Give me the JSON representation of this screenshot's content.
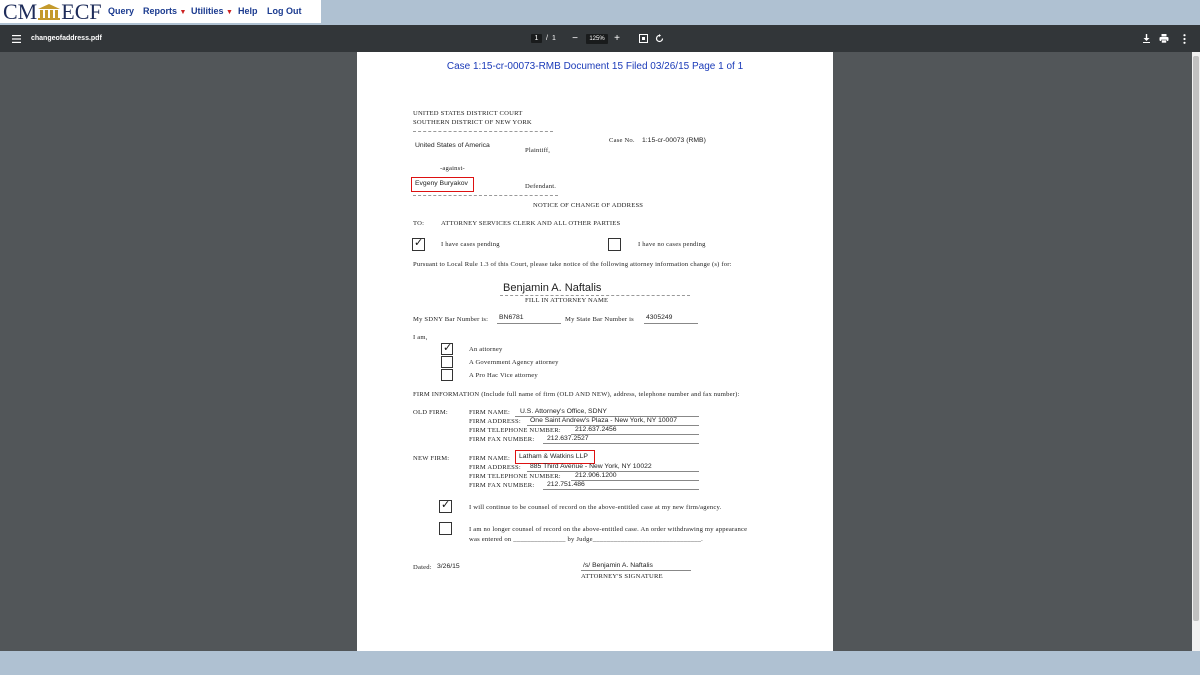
{
  "app": {
    "logo_left": "CM",
    "logo_right": "ECF",
    "menu": [
      {
        "label": "Query"
      },
      {
        "label": "Reports"
      },
      {
        "label": "Utilities"
      },
      {
        "label": "Help"
      },
      {
        "label": "Log Out"
      }
    ]
  },
  "viewer": {
    "filename": "changeofaddress.pdf",
    "page_current": "1",
    "page_sep": "/",
    "page_total": "1",
    "zoom": "125%"
  },
  "doc": {
    "header": "Case 1:15-cr-00073-RMB    Document 15    Filed 03/26/15    Page 1 of 1",
    "court1": "UNITED STATES DISTRICT COURT",
    "court2": "SOUTHERN DISTRICT OF NEW YORK",
    "plaintiff_name": "United States of America",
    "plaintiff_label": "Plaintiff,",
    "case_no_label": "Case No.",
    "case_no": "1:15-cr-00073 (RMB)",
    "against": "-against-",
    "defendant_name": "Evgeny Buryakov",
    "defendant_label": "Defendant.",
    "notice_title": "NOTICE OF CHANGE OF ADDRESS",
    "to_label": "TO:",
    "to_text": "ATTORNEY SERVICES CLERK AND ALL OTHER PARTIES",
    "cases_pending": "I have cases pending",
    "no_cases_pending": "I have no cases pending",
    "pursuant": "Pursuant to Local Rule 1.3 of this Court, please take notice of the following attorney information change (s) for:",
    "attorney_name": "Benjamin A. Naftalis",
    "fill_in_label": "FILL IN ATTORNEY NAME",
    "sdny_bar_label": "My SDNY Bar Number is:",
    "sdny_bar": "BN6781",
    "state_bar_label": "My State Bar Number is",
    "state_bar": "4305249",
    "i_am": "I am,",
    "opt_attorney": "An attorney",
    "opt_gov": "A Government Agency attorney",
    "opt_phv": "A Pro Hac Vice attorney",
    "firm_info": "FIRM INFORMATION (Include full name of firm (OLD AND NEW),  address, telephone number and fax number):",
    "old_firm_label": "OLD FIRM:",
    "new_firm_label": "NEW FIRM:",
    "firm_name_label": "FIRM NAME:",
    "firm_address_label": "FIRM ADDRESS:",
    "firm_tel_label": "FIRM TELEPHONE NUMBER:",
    "firm_fax_label": "FIRM FAX NUMBER:",
    "old_firm_name": "U.S. Attorney's Office, SDNY",
    "old_firm_address": "One Saint Andrew's Plaza - New York, NY 10007",
    "old_firm_tel": "212.637.2456",
    "old_firm_fax": "212.637.2527",
    "new_firm_name": "Latham & Watkins LLP",
    "new_firm_address": "885 Third Avenue - New York, NY 10022",
    "new_firm_tel": "212.906.1200",
    "new_firm_fax": "212.751.486",
    "continue_counsel": "I will continue to be counsel of record on the above-entitled case at my new firm/agency.",
    "no_longer_counsel": "I am no longer counsel of record on the above-entitled case.  An order withdrawing my appearance",
    "entered_on": "was entered on _______________ by Judge_______________________________.",
    "dated_label": "Dated:",
    "dated": "3/26/15",
    "signature": "/s/ Benjamin A. Naftalis",
    "signature_label": "ATTORNEY'S SIGNATURE"
  }
}
